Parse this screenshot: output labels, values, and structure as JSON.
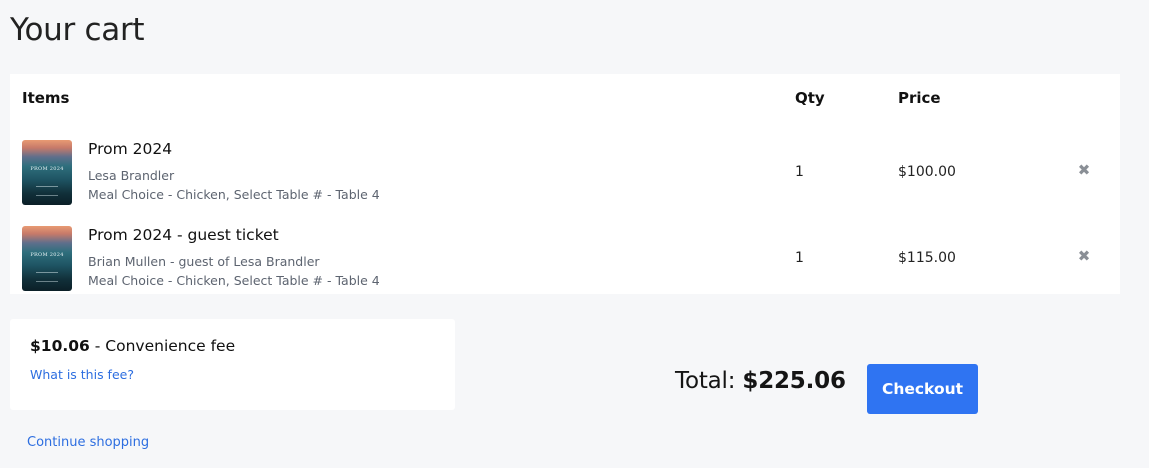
{
  "page": {
    "title": "Your cart"
  },
  "table": {
    "headers": {
      "items": "Items",
      "qty": "Qty",
      "price": "Price"
    },
    "rows": [
      {
        "title": "Prom 2024",
        "line1": "Lesa Brandler",
        "line2": "Meal Choice - Chicken, Select Table # - Table 4",
        "qty": "1",
        "price": "$100.00",
        "thumb_text": "PROM 2024",
        "remove_icon": "✖"
      },
      {
        "title": "Prom 2024 - guest ticket",
        "line1": "Brian Mullen - guest of Lesa Brandler",
        "line2": "Meal Choice - Chicken, Select Table # - Table 4",
        "qty": "1",
        "price": "$115.00",
        "thumb_text": "PROM 2024",
        "remove_icon": "✖"
      }
    ]
  },
  "fee": {
    "amount": "$10.06",
    "label": " - Convenience fee",
    "link": "What is this fee?"
  },
  "summary": {
    "total_label": "Total: ",
    "total_value": "$225.06",
    "checkout_label": "Checkout"
  },
  "footer": {
    "continue_label": "Continue shopping"
  },
  "colors": {
    "accent": "#2f74f2",
    "link": "#2d6ee0",
    "background": "#f6f7f9",
    "panel": "#ffffff"
  },
  "icons": {
    "remove": "close-icon"
  }
}
